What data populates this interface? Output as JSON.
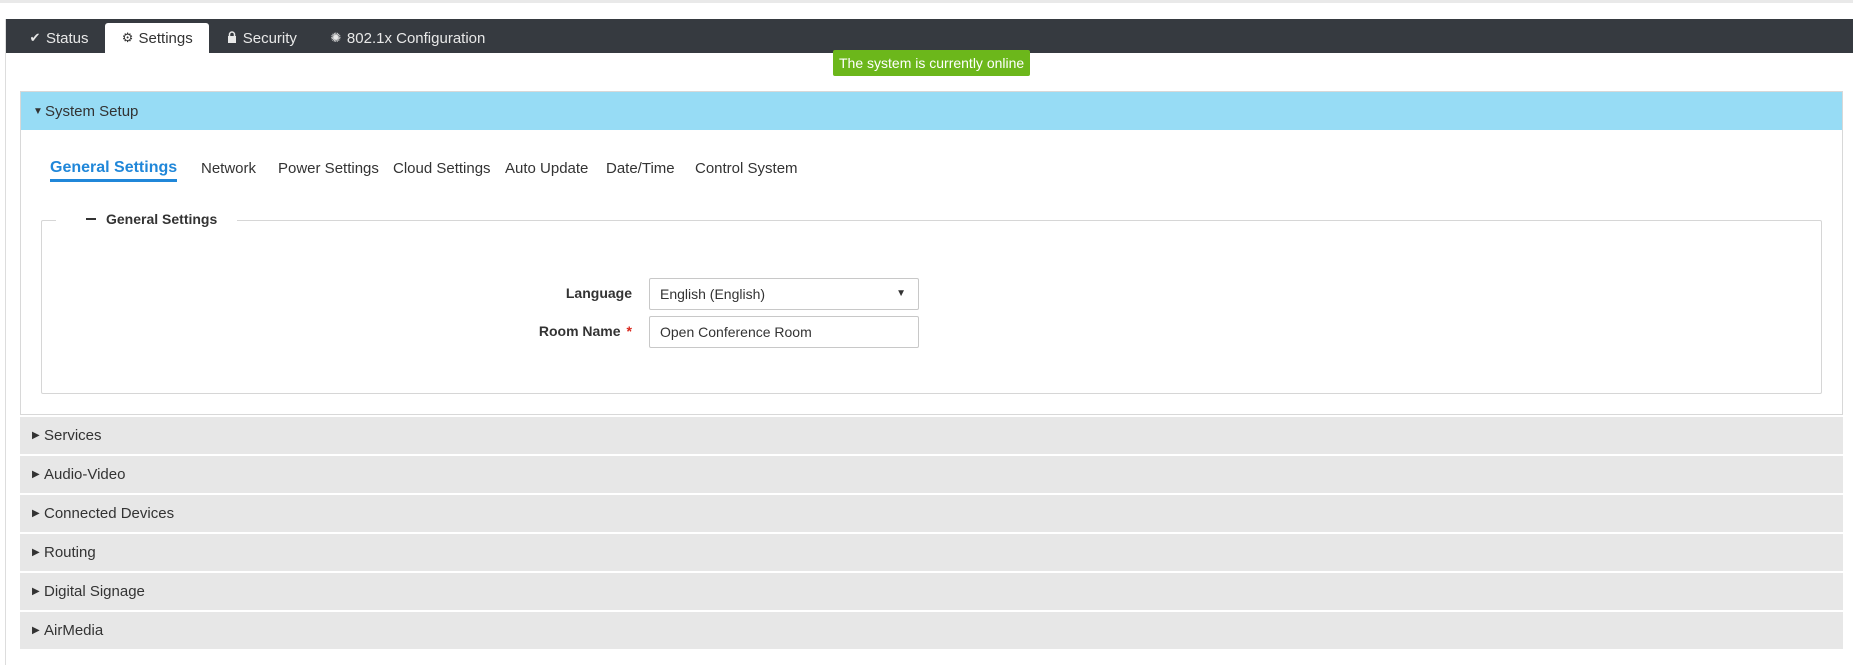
{
  "tabs": [
    {
      "label": "Status",
      "icon": "check-icon",
      "active": false
    },
    {
      "label": "Settings",
      "icon": "gear-icon",
      "active": true
    },
    {
      "label": "Security",
      "icon": "lock-icon",
      "active": false
    },
    {
      "label": "802.1x Configuration",
      "icon": "cog-icon",
      "active": false
    }
  ],
  "status_badge": "The system is currently online",
  "colors": {
    "tabbar": "#363a40",
    "online": "#6cb71b",
    "accordion_open": "#97dcf5",
    "accordion_closed": "#e7e7e7",
    "link_active": "#2087d9",
    "required": "#d9261c"
  },
  "system_setup": {
    "title": "System Setup",
    "subtabs": [
      "General Settings",
      "Network",
      "Power Settings",
      "Cloud Settings",
      "Auto Update",
      "Date/Time",
      "Control System"
    ],
    "active_subtab": "General Settings",
    "general_settings": {
      "legend": "General Settings",
      "language": {
        "label": "Language",
        "value": "English (English)"
      },
      "room_name": {
        "label": "Room Name",
        "required_mark": "*",
        "value": "Open Conference Room"
      }
    }
  },
  "sections": [
    "Services",
    "Audio-Video",
    "Connected Devices",
    "Routing",
    "Digital Signage",
    "AirMedia"
  ]
}
